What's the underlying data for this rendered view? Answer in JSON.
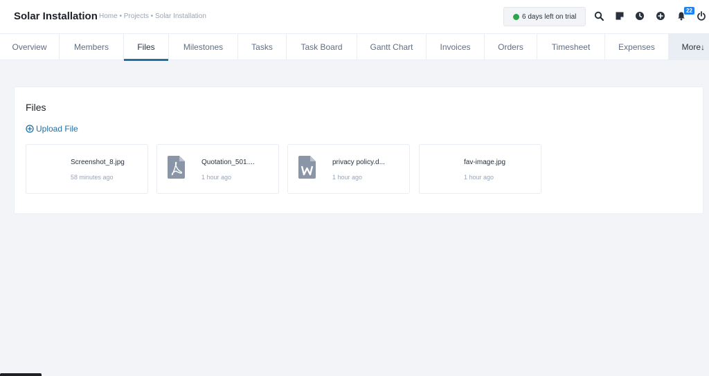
{
  "header": {
    "title": "Solar Installation",
    "breadcrumb": [
      "Home",
      "Projects",
      "Solar Installation"
    ],
    "separator": "•",
    "trial_text": "6 days left on trial",
    "notification_count": "22"
  },
  "tabs": [
    {
      "label": "Overview",
      "active": false
    },
    {
      "label": "Members",
      "active": false
    },
    {
      "label": "Files",
      "active": true
    },
    {
      "label": "Milestones",
      "active": false
    },
    {
      "label": "Tasks",
      "active": false
    },
    {
      "label": "Task Board",
      "active": false
    },
    {
      "label": "Gantt Chart",
      "active": false
    },
    {
      "label": "Invoices",
      "active": false
    },
    {
      "label": "Orders",
      "active": false
    },
    {
      "label": "Timesheet",
      "active": false
    },
    {
      "label": "Expenses",
      "active": false
    },
    {
      "label": "More↓",
      "active": false
    }
  ],
  "files_section": {
    "title": "Files",
    "upload_label": "Upload File",
    "files": [
      {
        "name": "Screenshot_8.jpg",
        "time": "58 minutes ago",
        "icon": "image-icon"
      },
      {
        "name": "Quotation_501....",
        "time": "1 hour ago",
        "icon": "pdf-file-icon"
      },
      {
        "name": "privacy policy.d...",
        "time": "1 hour ago",
        "icon": "word-file-icon"
      },
      {
        "name": "fav-image.jpg",
        "time": "1 hour ago",
        "icon": "image-icon"
      }
    ]
  },
  "colors": {
    "accent": "#1d6fa5",
    "trial_dot": "#2ba74a",
    "badge": "#1d82f5",
    "file_icon": "#8a96a8"
  }
}
